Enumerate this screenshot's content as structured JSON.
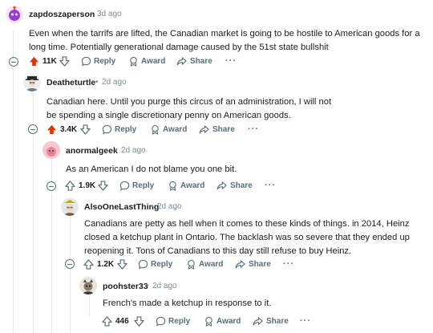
{
  "comments": [
    {
      "author": "zapdoszaperson",
      "time": "3d ago",
      "body": "Even when the tarrifs are lifted, the Canadian market is going to be hostile to American goods for a long time. Potentially generational damage caused by the 51st state bullshit",
      "votes": "11K",
      "upvoted": true
    },
    {
      "author": "Deatheturtle",
      "time": "2d ago",
      "body": "Canadian here. Until you purge this circus of an administration, I will not be spending a single discretionary penny on American goods.",
      "votes": "3.4K",
      "upvoted": true
    },
    {
      "author": "anormalgeek",
      "time": "2d ago",
      "body": "As an American I do not blame you one bit.",
      "votes": "1.9K",
      "upvoted": false
    },
    {
      "author": "AlsoOneLastThing",
      "time": "2d ago",
      "body": "Canadians are petty as hell when it comes to these kinds of things. in 2014, Heinz closed a ketchup plant in Ontario. The backlash was so severe that they ended up reopening it. Tons of Canadians to this day still refuse to buy Heinz.",
      "votes": "1.2K",
      "upvoted": false
    },
    {
      "author": "poohster33",
      "time": "2d ago",
      "body": "French's made a ketchup in response to it.",
      "votes": "446",
      "upvoted": false
    }
  ],
  "actions": {
    "reply": "Reply",
    "award": "Award",
    "share": "Share",
    "more": "···",
    "separator": "•"
  },
  "colors": {
    "upvote_active": "#d93900",
    "icon_gray": "#576f76",
    "rail": "#e5e8ea"
  }
}
